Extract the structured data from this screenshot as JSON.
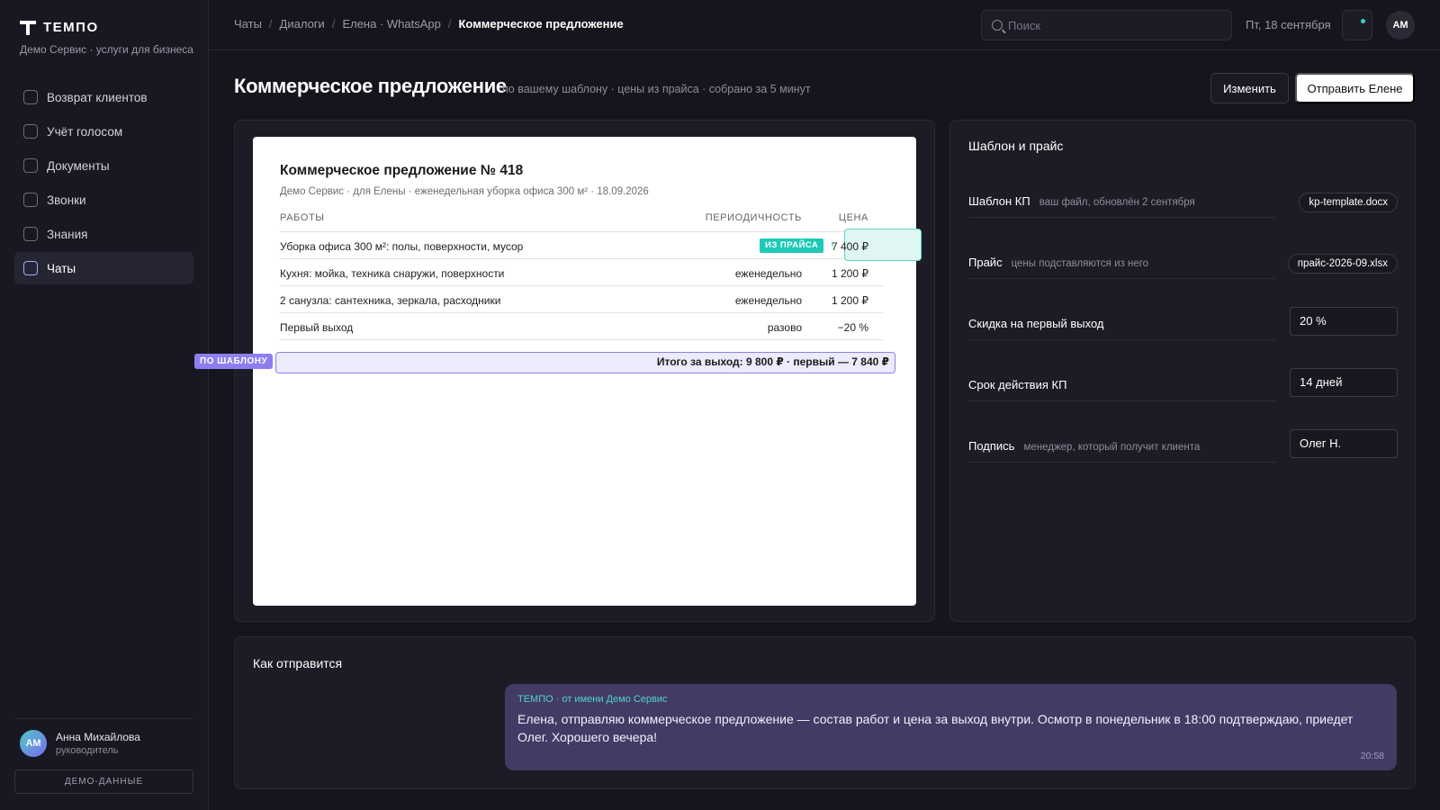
{
  "brand": {
    "name": "ТЕМПО",
    "subtitle": "Демо Сервис · услуги для бизнеса"
  },
  "nav": [
    {
      "label": "Возврат клиентов",
      "active": false
    },
    {
      "label": "Учёт голосом",
      "active": false
    },
    {
      "label": "Документы",
      "active": false
    },
    {
      "label": "Звонки",
      "active": false
    },
    {
      "label": "Знания",
      "active": false
    },
    {
      "label": "Чаты",
      "active": true
    }
  ],
  "user": {
    "initials": "АМ",
    "name": "Анна Михайлова",
    "role": "руководитель"
  },
  "demo_label": "ДЕМО-ДАННЫЕ",
  "breadcrumb": [
    "Чаты",
    "Диалоги",
    "Елена · WhatsApp",
    "Коммерческое предложение"
  ],
  "search": {
    "placeholder": "Поиск"
  },
  "date": "Пт, 18 сентября",
  "top_avatar": "АМ",
  "colors": {
    "accent_teal": "#1fc9b8",
    "accent_violet": "#8b7ff0",
    "bubble": "#433a66"
  },
  "page": {
    "title": "Коммерческое предложение",
    "subtitle": "по вашему шаблону · цены из прайса · собрано за 5 минут",
    "edit_label": "Изменить",
    "send_label": "Отправить Елене"
  },
  "doc": {
    "title": "Коммерческое предложение № 418",
    "meta": "Демо Сервис · для Елены · еженедельная уборка офиса 300 м² · 18.09.2026",
    "col_work": "РАБОТЫ",
    "col_period": "ПЕРИОДИЧНОСТЬ",
    "col_price": "ЦЕНА",
    "price_tag": "ИЗ ПРАЙСА",
    "rows": [
      {
        "work": "Уборка офиса 300 м²: полы, поверхности, мусор",
        "period": "",
        "price": "7 400 ₽"
      },
      {
        "work": "Кухня: мойка, техника снаружи, поверхности",
        "period": "еженедельно",
        "price": "1 200 ₽"
      },
      {
        "work": "2 санузла: сантехника, зеркала, расходники",
        "period": "еженедельно",
        "price": "1 200 ₽"
      },
      {
        "work": "Первый выход",
        "period": "разово",
        "price": "−20 %"
      }
    ],
    "total": "Итого за выход: 9 800 ₽ · первый — 7 840 ₽",
    "template_tag": "ПО ШАБЛОНУ"
  },
  "template": {
    "title": "Шаблон и прайс",
    "rows": [
      {
        "label": "Шаблон КП",
        "hint": "ваш файл, обновлён 2 сентября",
        "value": "kp-template.docx",
        "kind": "chip"
      },
      {
        "label": "Прайс",
        "hint": "цены подставляются из него",
        "value": "прайс-2026-09.xlsx",
        "kind": "chip"
      },
      {
        "label": "Скидка на первый выход",
        "hint": "",
        "value": "20 %",
        "kind": "field"
      },
      {
        "label": "Срок действия КП",
        "hint": "",
        "value": "14 дней",
        "kind": "field"
      },
      {
        "label": "Подпись",
        "hint": "менеджер, который получит клиента",
        "value": "Олег Н.",
        "kind": "field"
      }
    ]
  },
  "send": {
    "title": "Как отправится",
    "from": "ТЕМПО · от имени Демо Сервис",
    "text": "Елена, отправляю коммерческое предложение — состав работ и цена за выход внутри. Осмотр в понедельник в 18:00 подтверждаю, приедет Олег. Хорошего вечера!",
    "time": "20:58"
  }
}
